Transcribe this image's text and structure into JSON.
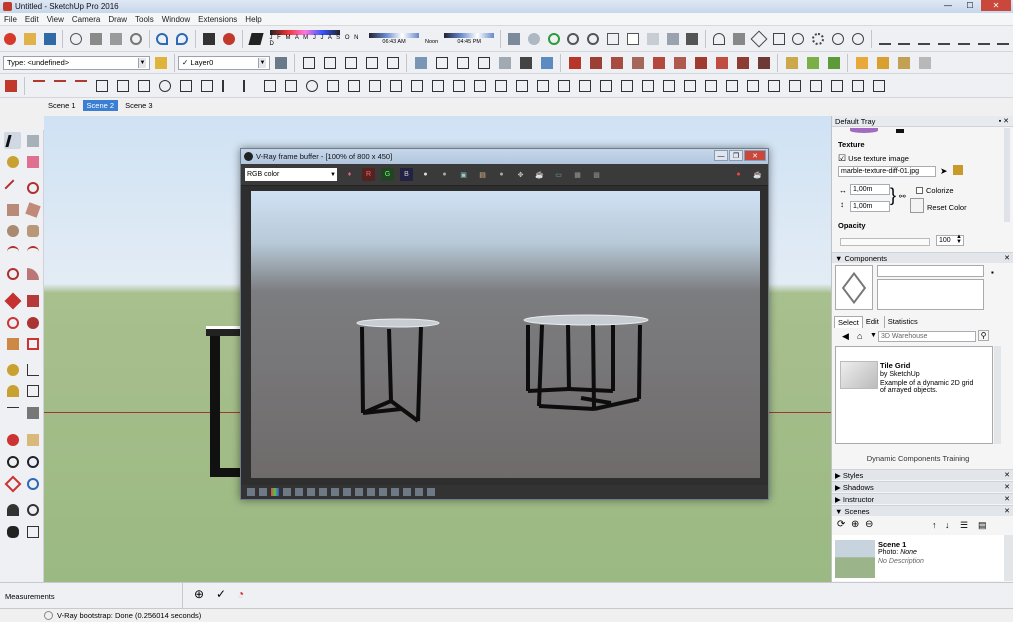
{
  "window": {
    "title": "Untitled - SketchUp Pro 2016"
  },
  "menu": [
    "File",
    "Edit",
    "View",
    "Camera",
    "Draw",
    "Tools",
    "Window",
    "Extensions",
    "Help"
  ],
  "shadows": {
    "months": "J F M A M J J A S O N D",
    "time_start": "06:43 AM",
    "time_mid": "Noon",
    "time_end": "04:45 PM"
  },
  "toolbar2": {
    "type_value": "Type: <undefined>",
    "layer_value": "Layer0"
  },
  "scenes": [
    {
      "label": "Scene 1",
      "active": false
    },
    {
      "label": "Scene 2",
      "active": true
    },
    {
      "label": "Scene 3",
      "active": false
    }
  ],
  "vray": {
    "title": "V-Ray frame buffer - [100% of 800 x 450]",
    "channel": "RGB color",
    "channel_buttons": [
      "R",
      "G",
      "B"
    ]
  },
  "tray": {
    "title": "Default Tray",
    "texture": {
      "heading": "Texture",
      "use_texture_label": "Use texture image",
      "file_name": "marble-texture-diff-01.jpg",
      "width": "1,00m",
      "height": "1,00m",
      "colorize_label": "Colorize",
      "reset_color_label": "Reset Color",
      "opacity_label": "Opacity",
      "opacity_value": "100"
    },
    "components": {
      "heading": "Components",
      "tabs": [
        "Select",
        "Edit",
        "Statistics"
      ],
      "search_placeholder": "3D Warehouse",
      "item_name": "Tile Grid",
      "item_author": "by SketchUp",
      "item_desc": "Example of a dynamic 2D grid of arrayed objects.",
      "footer": "Dynamic Components Training"
    },
    "collapsed_panels": [
      "Styles",
      "Shadows",
      "Instructor"
    ],
    "scenes_panel": {
      "heading": "Scenes",
      "scene_name": "Scene 1",
      "photo_label": "Photo:",
      "photo_value": "None",
      "desc": "No Description"
    }
  },
  "measurements_label": "Measurements",
  "status_text": "V-Ray bootstrap: Done (0.256014 seconds)",
  "colors": {
    "accent": "#3b7fd4",
    "close": "#c9483b",
    "vray_bg": "#2e2e2e"
  }
}
